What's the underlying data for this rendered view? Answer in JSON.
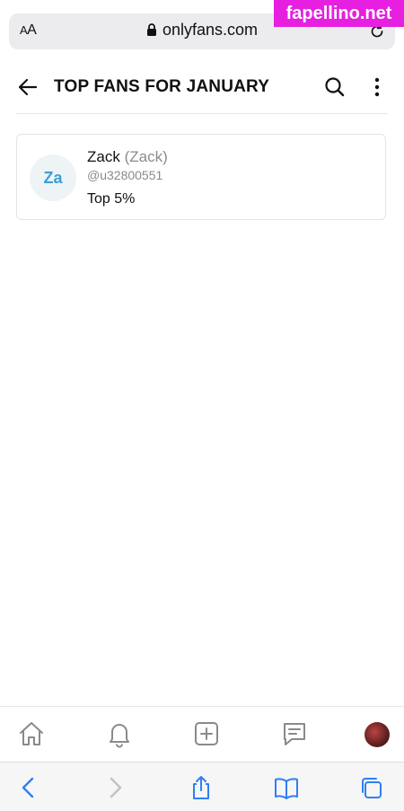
{
  "browser": {
    "aa_label_small": "A",
    "aa_label_large": "A",
    "url": "onlyfans.com"
  },
  "watermark": "fapellino.net",
  "header": {
    "title": "TOP FANS FOR JANUARY"
  },
  "fans": [
    {
      "initials": "Za",
      "name": "Zack",
      "display_name": "(Zack)",
      "handle": "@u32800551",
      "rank": "Top 5%"
    }
  ],
  "colors": {
    "accent": "#3a9fd6",
    "safari_blue": "#2f7ef6",
    "watermark_bg": "#e61fe0"
  },
  "icons": {
    "header": [
      "arrow-left-icon",
      "search-icon",
      "more-vertical-icon"
    ],
    "app_nav": [
      "home-icon",
      "bell-icon",
      "plus-square-icon",
      "message-icon",
      "profile-avatar"
    ],
    "safari": [
      "chevron-left-icon",
      "chevron-right-icon",
      "share-icon",
      "book-icon",
      "tabs-icon"
    ]
  }
}
